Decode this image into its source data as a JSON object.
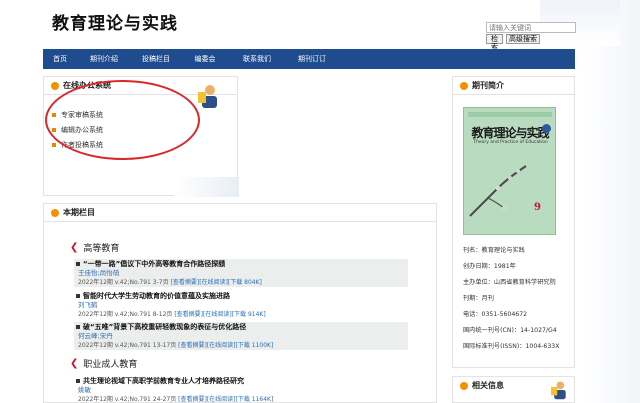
{
  "header": {
    "title": "教育理论与实践",
    "search_placeholder": "请输入关键词",
    "search_button": "检索",
    "advanced_button": "高级搜索"
  },
  "nav": {
    "items": [
      "首页",
      "期刊介绍",
      "投稿栏目",
      "编委会",
      "联系我们",
      "期刊订订"
    ]
  },
  "office": {
    "title": "在线办公系统",
    "items": [
      "专家审稿系统",
      "编辑办公系统",
      "作者投稿系统"
    ]
  },
  "issue": {
    "title": "本期栏目",
    "categories": [
      {
        "name": "高等教育",
        "articles": [
          {
            "title": "“一带一路”倡议下中外高等教育合作路径探赜",
            "authors": "王佳怡;尚怡萌",
            "meta": "2022年12期 v.42;No.791 3-7页",
            "links": "[查看摘要][在线阅读][下载 804K]"
          },
          {
            "title": "智能时代大学生劳动教育的价值意蕴及实施进路",
            "authors": "刘飞鹤",
            "meta": "2022年12期 v.42;No.791 8-12页",
            "links": "[查看摘要][在线阅读][下载 914K]"
          },
          {
            "title": "破“五唯”背景下高校重研轻教现象的表征与优化路径",
            "authors": "何云峰;宋丹",
            "meta": "2022年12期 v.42;No.791 13-17页",
            "links": "[查看摘要][在线阅读][下载 1100K]"
          }
        ]
      },
      {
        "name": "职业成人教育",
        "articles": [
          {
            "title": "共生理论视域下高职学前教育专业人才培养路径研究",
            "authors": "姚敏",
            "meta": "2022年12期 v.42;No.791 24-27页",
            "links": "[查看摘要][在线阅读][下载 1164K]"
          }
        ]
      }
    ]
  },
  "intro": {
    "title": "期刊简介",
    "cover": {
      "title": "教育理论与实践",
      "subtitle": "Theory and Practice of Education",
      "issue_number": "9"
    },
    "info": [
      "刊名：教育理论与实践",
      "创办日期：1981年",
      "主办单位：山西省教育科学研究院",
      "刊期：月刊",
      "电话：0351-5604672",
      "国内统一刊号(CN)：14-1027/G4",
      "国际标准刊号(ISSN)：1004-633X"
    ]
  },
  "related": {
    "title": "相关信息"
  },
  "colors": {
    "nav_bg": "#1f4c8e",
    "accent_orange": "#f29100",
    "annotation_red": "#d8282a",
    "link_blue": "#2a6db5"
  }
}
